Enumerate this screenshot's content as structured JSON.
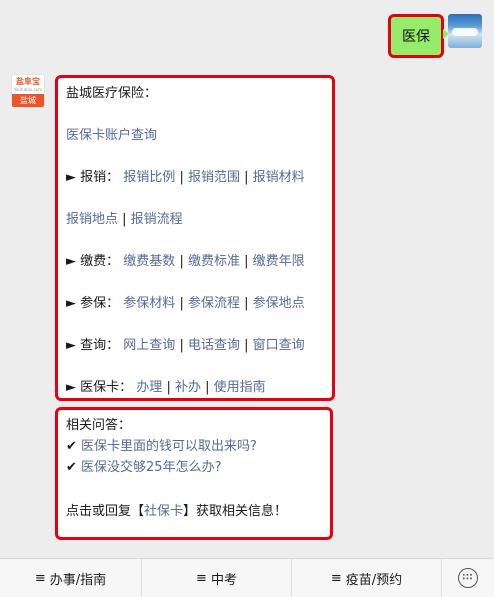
{
  "outgoing": {
    "text": "医保"
  },
  "bot": {
    "logo_text": "盐阜宝",
    "logo_sub": "Yanfubao.com",
    "city": "盐城"
  },
  "reply1": {
    "title": "盐城医疗保险：",
    "account_link": "医保卡账户查询",
    "groups": [
      {
        "arrow": "►",
        "label": "报销：",
        "links": [
          "报销比例",
          "报销范围",
          "报销材料"
        ]
      },
      {
        "label": "",
        "links": [
          "报销地点",
          "报销流程"
        ]
      },
      {
        "arrow": "►",
        "label": "缴费：",
        "links": [
          "缴费基数",
          "缴费标准",
          "缴费年限"
        ]
      },
      {
        "arrow": "►",
        "label": "参保：",
        "links": [
          "参保材料",
          "参保流程",
          "参保地点"
        ]
      },
      {
        "arrow": "►",
        "label": "查询：",
        "links": [
          "网上查询",
          "电话查询",
          "窗口查询"
        ]
      },
      {
        "arrow": "►",
        "label": "医保卡：",
        "links": [
          "办理",
          "补办",
          "使用指南"
        ]
      }
    ],
    "separator": "|"
  },
  "reply2": {
    "title": "相关问答：",
    "check": "✔",
    "questions": [
      "医保卡里面的钱可以取出来吗?",
      "医保没交够25年怎么办?"
    ],
    "tip_prefix": "点击或回复【",
    "tip_link": "社保卡",
    "tip_suffix": "】获取相关信息！"
  },
  "menu": {
    "icon": "≡",
    "items": [
      "办事/指南",
      "中考",
      "疫苗/预约"
    ]
  },
  "colors": {
    "link": "#576b95",
    "highlight": "#e60012",
    "outgoing_bubble": "#95ec69"
  }
}
